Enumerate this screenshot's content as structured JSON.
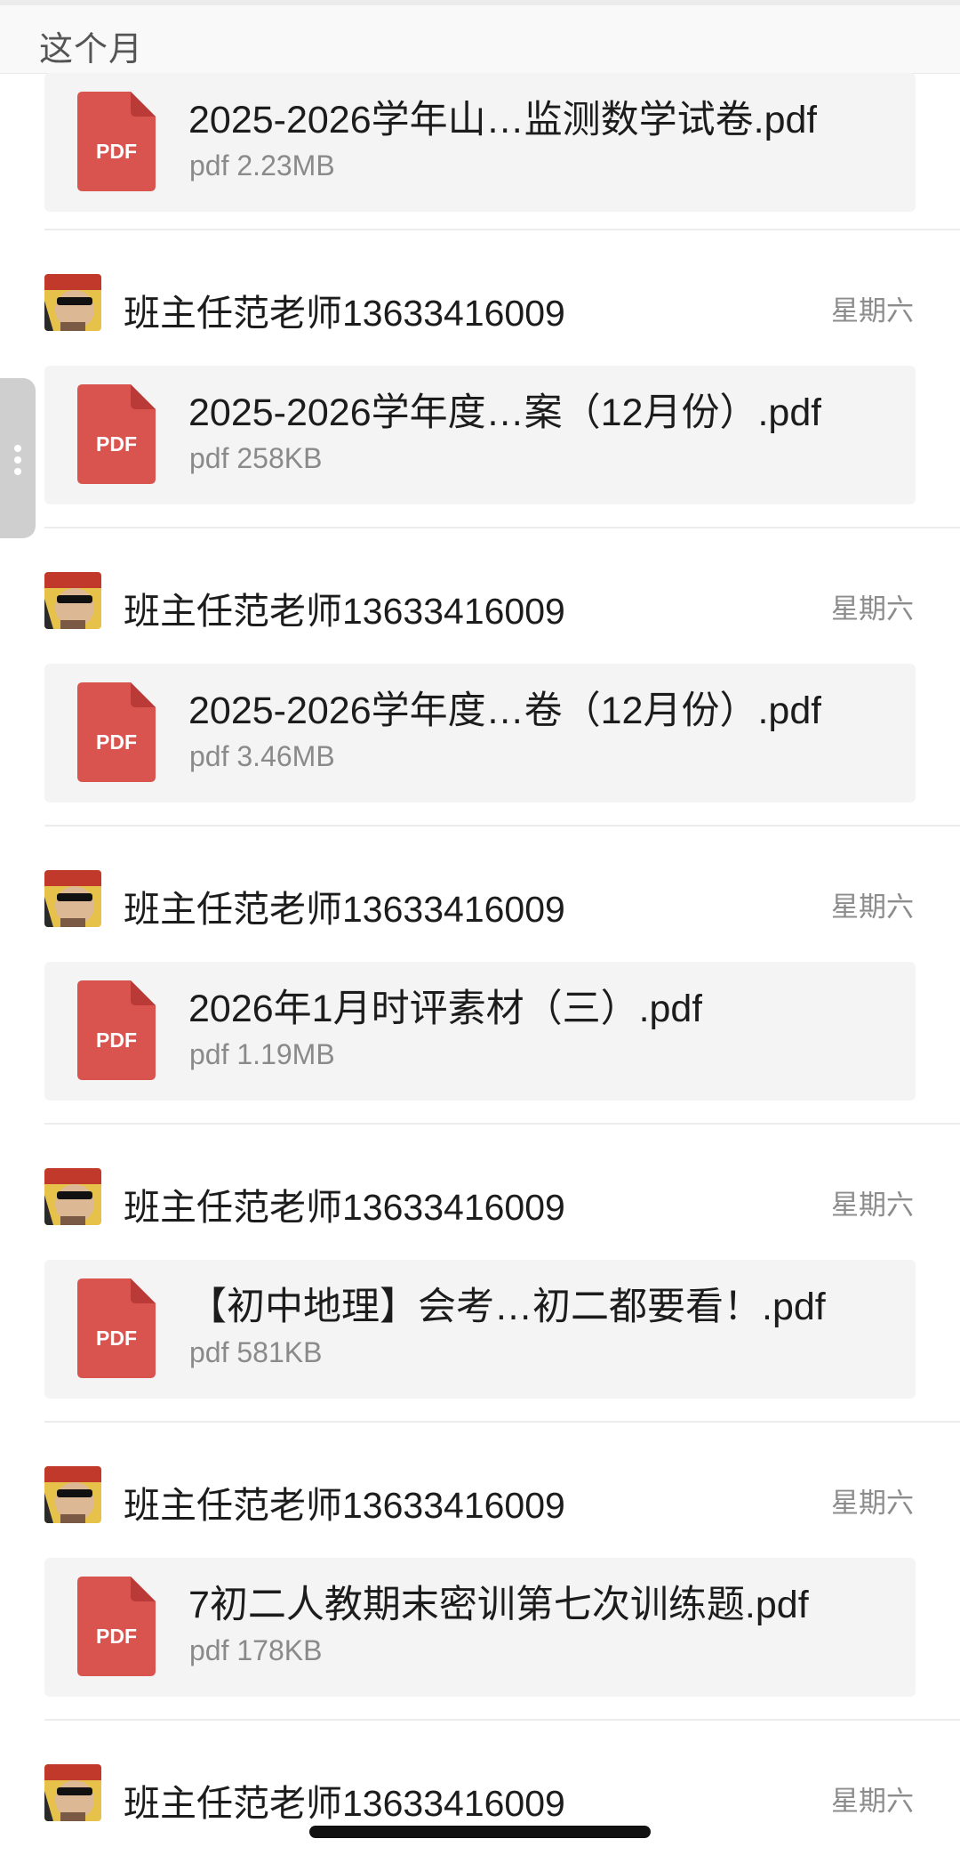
{
  "section": {
    "title": "这个月"
  },
  "feed": {
    "first_file": {
      "name": "2025-2026学年山…监测数学试卷.pdf",
      "meta": "pdf 2.23MB",
      "icon": "pdf-file-icon",
      "icon_label": "PDF"
    },
    "items": [
      {
        "sender": "班主任范老师13633416009",
        "time": "星期六",
        "avatar": "avatar-icon",
        "file_name": "2025-2026学年度…案（12月份）.pdf",
        "file_meta": "pdf 258KB",
        "icon_label": "PDF"
      },
      {
        "sender": "班主任范老师13633416009",
        "time": "星期六",
        "avatar": "avatar-icon",
        "file_name": "2025-2026学年度…卷（12月份）.pdf",
        "file_meta": "pdf 3.46MB",
        "icon_label": "PDF"
      },
      {
        "sender": "班主任范老师13633416009",
        "time": "星期六",
        "avatar": "avatar-icon",
        "file_name": "2026年1月时评素材（三）.pdf",
        "file_meta": "pdf 1.19MB",
        "icon_label": "PDF"
      },
      {
        "sender": "班主任范老师13633416009",
        "time": "星期六",
        "avatar": "avatar-icon",
        "file_name": "【初中地理】会考…初二都要看！.pdf",
        "file_meta": "pdf 581KB",
        "icon_label": "PDF"
      },
      {
        "sender": "班主任范老师13633416009",
        "time": "星期六",
        "avatar": "avatar-icon",
        "file_name": "7初二人教期末密训第七次训练题.pdf",
        "file_meta": "pdf 178KB",
        "icon_label": "PDF"
      }
    ],
    "last_sender": {
      "sender": "班主任范老师13633416009",
      "time": "星期六",
      "avatar": "avatar-icon"
    }
  },
  "colors": {
    "pdf_red": "#d9534f",
    "pdf_fold": "#b93a36",
    "card_bg": "#f4f4f4",
    "muted_text": "#8a8a8a"
  },
  "icons": {
    "side_handle": "more-vertical-icon"
  }
}
